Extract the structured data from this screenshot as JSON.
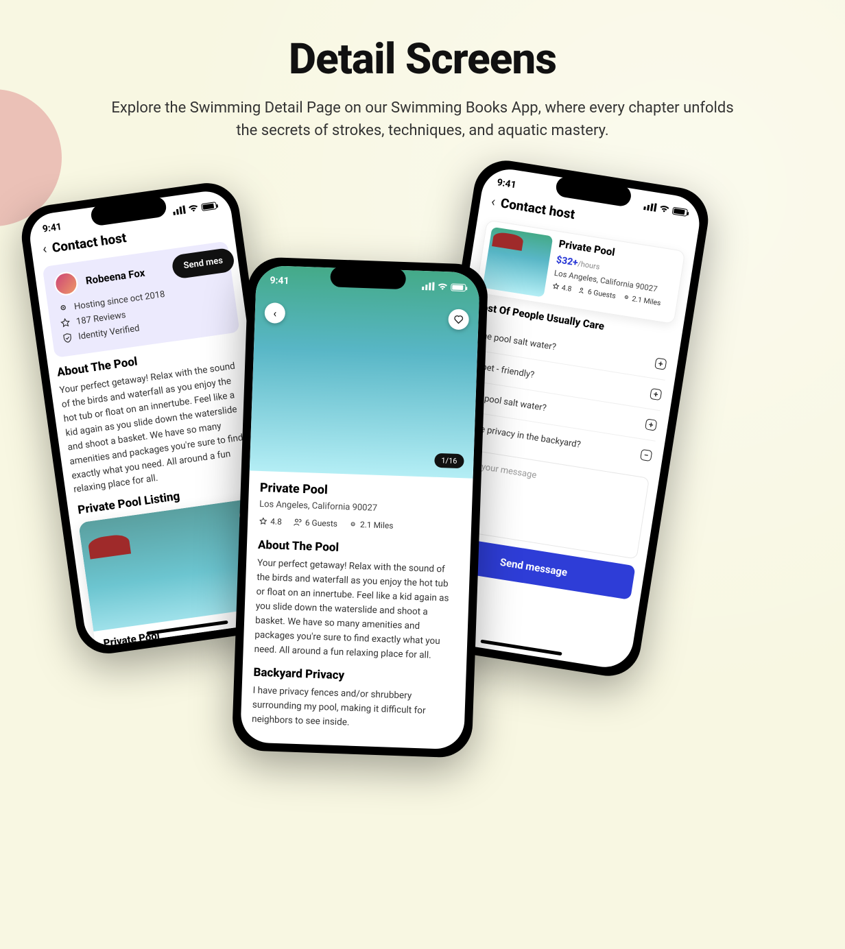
{
  "headline": {
    "title": "Detail Screens",
    "subtitle": "Explore the Swimming Detail Page on our Swimming Books App, where every chapter unfolds the secrets of strokes, techniques, and aquatic mastery."
  },
  "common": {
    "time": "9:41",
    "rating": "4.8",
    "guests": "6 Guests",
    "miles": "2.1 Miles",
    "location": "Los Angeles, California 90027",
    "pool_title": "Private Pool",
    "price": "$32+",
    "per": "/hours",
    "about_heading": "About The Pool",
    "about_text": "Your perfect getaway! Relax with the sound of the birds and waterfall as you enjoy the hot tub or float on an innertube. Feel like a kid again as you slide down the waterslide and shoot a basket. We have so many amenities and packages you're sure to find exactly what you need. All around a fun relaxing place for all."
  },
  "phone1": {
    "nav": "Contact host",
    "host_name": "Robeena Fox",
    "hosting_since": "Hosting since oct 2018",
    "reviews": "187 Reviews",
    "identity": "Identity Verified",
    "send_msg": "Send mes",
    "listing_heading": "Private Pool Listing",
    "listing_name": "Private Pool"
  },
  "phone2": {
    "counter": "1/16",
    "backyard_heading": "Backyard Privacy",
    "backyard_text": "I have privacy fences and/or shrubbery surrounding my pool, making it difficult for neighbors to see inside."
  },
  "phone3": {
    "nav": "Contact host",
    "faq_heading": "Most Of People Usually Care",
    "faq": [
      {
        "q": "Is the pool salt water?",
        "state": "+"
      },
      {
        "q": "Is it pet - friendly?",
        "state": "+"
      },
      {
        "q": "Is the pool salt water?",
        "state": "+"
      },
      {
        "q": "Is there privacy in the backyard?",
        "state": "−"
      }
    ],
    "placeholder": "Enter your message",
    "send": "Send message"
  }
}
